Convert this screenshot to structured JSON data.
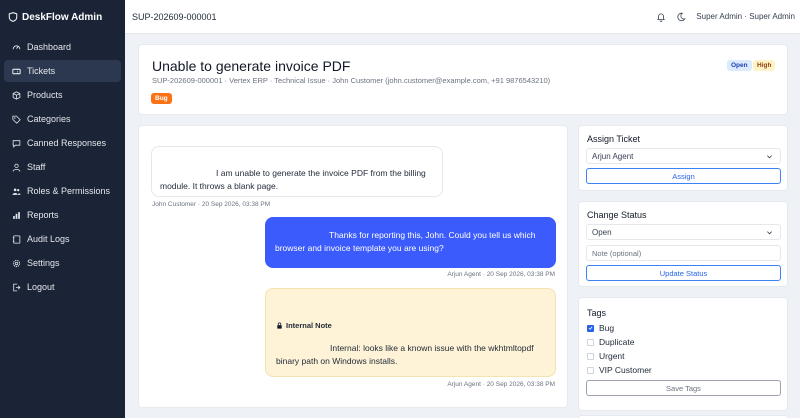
{
  "brand": {
    "name": "DeskFlow Admin",
    "icon": "shield-icon"
  },
  "sidebar": {
    "items": [
      {
        "label": "Dashboard",
        "icon": "speedometer-icon",
        "active": false
      },
      {
        "label": "Tickets",
        "icon": "ticket-icon",
        "active": true
      },
      {
        "label": "Products",
        "icon": "box-icon",
        "active": false
      },
      {
        "label": "Categories",
        "icon": "tag-icon",
        "active": false
      },
      {
        "label": "Canned Responses",
        "icon": "chat-icon",
        "active": false
      },
      {
        "label": "Staff",
        "icon": "person-icon",
        "active": false
      },
      {
        "label": "Roles & Permissions",
        "icon": "people-icon",
        "active": false
      },
      {
        "label": "Reports",
        "icon": "bar-chart-icon",
        "active": false
      },
      {
        "label": "Audit Logs",
        "icon": "journal-icon",
        "active": false
      },
      {
        "label": "Settings",
        "icon": "gear-icon",
        "active": false
      },
      {
        "label": "Logout",
        "icon": "logout-icon",
        "active": false
      }
    ]
  },
  "topbar": {
    "ticket_id": "SUP-202609-000001",
    "user": "Super Admin · Super Admin"
  },
  "ticket": {
    "title": "Unable to generate invoice PDF",
    "subtitle": "SUP-202609-000001 · Vertex ERP · Technical Issue · John Customer (john.customer@example.com, +91 9876543210)",
    "status": "Open",
    "priority": "High",
    "label": "Bug"
  },
  "messages": [
    {
      "text": "I am unable to generate the invoice PDF from the billing module. It throws a blank page.",
      "meta": "John Customer · 20 Sep 2026, 03:38 PM"
    },
    {
      "text": "Thanks for reporting this, John. Could you tell us which browser and invoice template you are using?",
      "meta": "Arjun Agent · 20 Sep 2026, 03:38 PM"
    },
    {
      "note_title": "Internal Note",
      "text": "Internal: looks like a known issue with the wkhtmltopdf binary path on Windows installs.",
      "meta": "Arjun Agent · 20 Sep 2026, 03:38 PM"
    }
  ],
  "assign": {
    "title": "Assign Ticket",
    "selected": "Arjun Agent",
    "button": "Assign"
  },
  "status_panel": {
    "title": "Change Status",
    "selected": "Open",
    "note_placeholder": "Note (optional)",
    "button": "Update Status"
  },
  "tags": {
    "title": "Tags",
    "items": [
      {
        "label": "Bug",
        "checked": true
      },
      {
        "label": "Duplicate",
        "checked": false
      },
      {
        "label": "Urgent",
        "checked": false
      },
      {
        "label": "VIP Customer",
        "checked": false
      }
    ],
    "button": "Save Tags"
  },
  "colors": {
    "sidebar": "#1b2436",
    "accent": "#3b5bfd",
    "note": "#fef3d6",
    "bug": "#f97316"
  }
}
